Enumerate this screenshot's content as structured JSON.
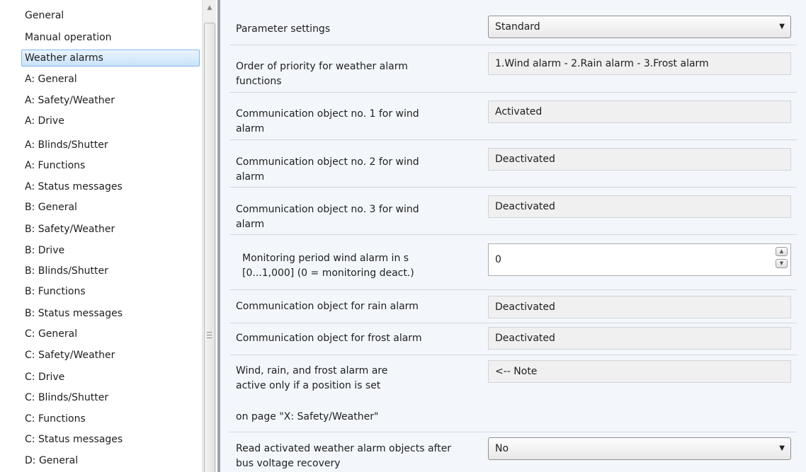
{
  "sidebar": {
    "items": [
      {
        "label": "General"
      },
      {
        "label": "Manual operation"
      },
      {
        "label": "Weather alarms",
        "selected": true
      },
      {
        "label": "A: General"
      },
      {
        "label": "A: Safety/Weather"
      },
      {
        "label": "A: Drive"
      },
      {
        "label": "A: Blinds/Shutter"
      },
      {
        "label": "A: Functions"
      },
      {
        "label": "A: Status messages"
      },
      {
        "label": "B: General"
      },
      {
        "label": "B: Safety/Weather"
      },
      {
        "label": "B: Drive"
      },
      {
        "label": "B: Blinds/Shutter"
      },
      {
        "label": "B: Functions"
      },
      {
        "label": "B: Status messages"
      },
      {
        "label": "C: General"
      },
      {
        "label": "C: Safety/Weather"
      },
      {
        "label": "C: Drive"
      },
      {
        "label": "C: Blinds/Shutter"
      },
      {
        "label": "C: Functions"
      },
      {
        "label": "C: Status messages"
      },
      {
        "label": "D: General"
      }
    ]
  },
  "params": {
    "parameter_settings": {
      "label": "Parameter settings",
      "value": "Standard"
    },
    "priority_order": {
      "label": "Order of priority for weather alarm functions",
      "value": "1.Wind alarm - 2.Rain alarm - 3.Frost alarm"
    },
    "co1_wind": {
      "label": "Communication object no. 1 for wind alarm",
      "value": "Activated"
    },
    "co2_wind": {
      "label": "Communication object no. 2 for wind alarm",
      "value": "Deactivated"
    },
    "co3_wind": {
      "label": "Communication object no. 3 for wind alarm",
      "value": "Deactivated"
    },
    "monitoring_period": {
      "label": "Monitoring period wind alarm in s [0...1,000] (0 = monitoring deact.)",
      "value": "0"
    },
    "co_rain": {
      "label": "Communication object for rain alarm",
      "value": "Deactivated"
    },
    "co_frost": {
      "label": "Communication object for frost alarm",
      "value": "Deactivated"
    },
    "note": {
      "label": "Wind, rain, and frost alarm are active only if a position is set",
      "value": "<-- Note"
    },
    "note_page": {
      "label": "on page \"X: Safety/Weather\""
    },
    "read_after_recovery": {
      "label": "Read activated weather alarm objects after bus voltage recovery",
      "value": "No"
    }
  },
  "icons": {
    "dropdown_arrow": "chevron-down-icon",
    "spin_up": "arrow-up-icon",
    "spin_down": "arrow-down-icon",
    "scroll_up": "scroll-up-icon",
    "scroll_grip": "grip-icon"
  },
  "colors": {
    "selection_border": "#84b8ec",
    "panel_background": "#f3f7fc",
    "readonly_field": "#f0f0f0"
  }
}
